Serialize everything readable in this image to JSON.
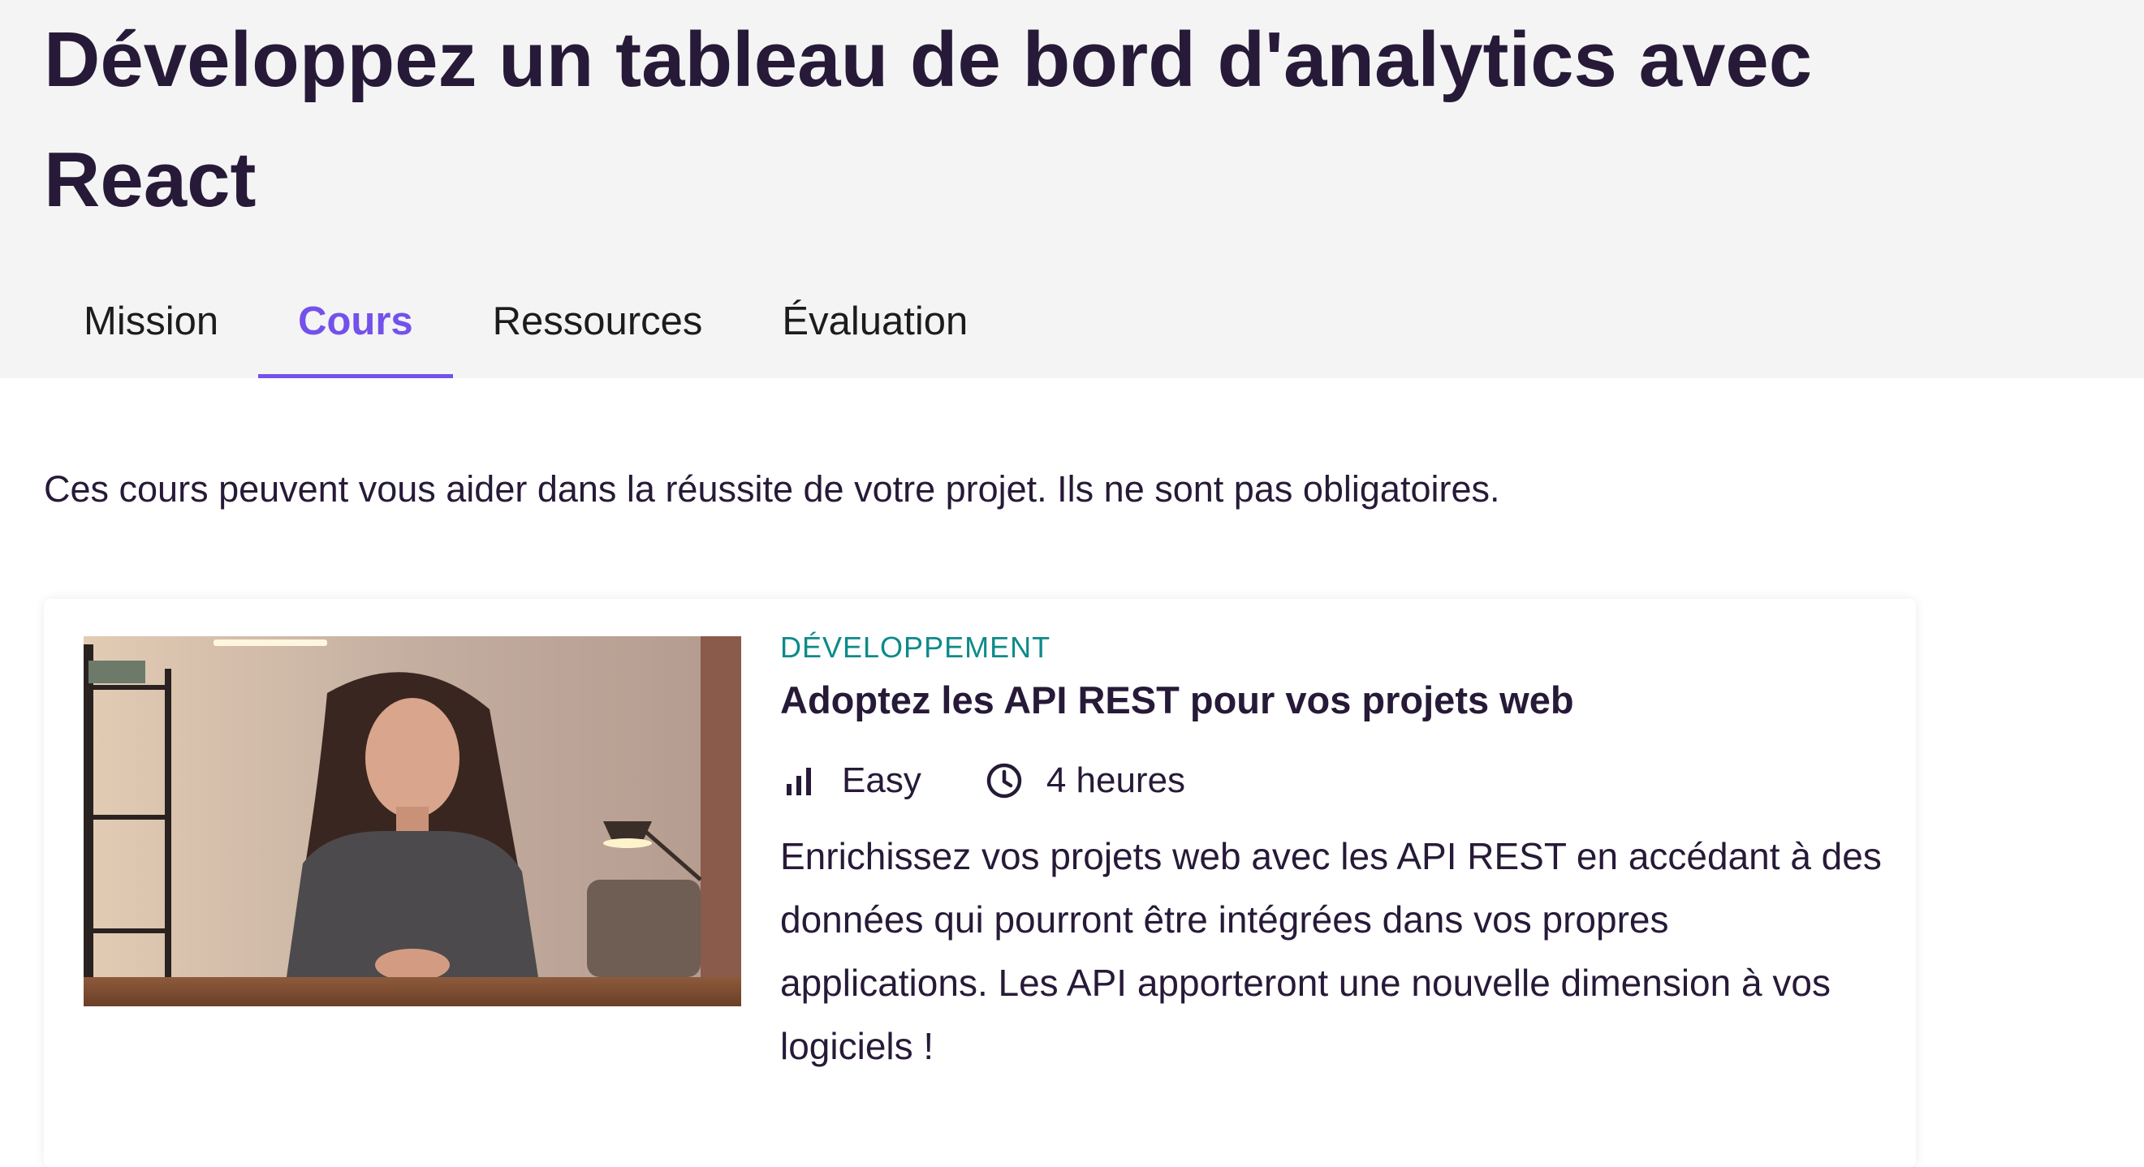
{
  "header": {
    "title": "Développez un tableau de bord d'analytics avec React"
  },
  "tabs": [
    {
      "label": "Mission",
      "active": false
    },
    {
      "label": "Cours",
      "active": true
    },
    {
      "label": "Ressources",
      "active": false
    },
    {
      "label": "Évaluation",
      "active": false
    }
  ],
  "colors": {
    "accent": "#7451eb",
    "category": "#0d8a8a",
    "text": "#271a38",
    "header_bg": "#f4f4f4"
  },
  "main": {
    "intro": "Ces cours peuvent vous aider dans la réussite de votre projet. Ils ne sont pas obligatoires.",
    "course": {
      "category": "DÉVELOPPEMENT",
      "title": "Adoptez les API REST pour vos projets web",
      "difficulty": "Easy",
      "difficulty_icon": "bar-chart-icon",
      "duration": "4 heures",
      "duration_icon": "clock-icon",
      "description": "Enrichissez vos projets web avec les API REST en accédant à des données qui pourront être intégrées dans vos propres applications. Les API apporteront une nouvelle dimension à vos logiciels !"
    }
  }
}
